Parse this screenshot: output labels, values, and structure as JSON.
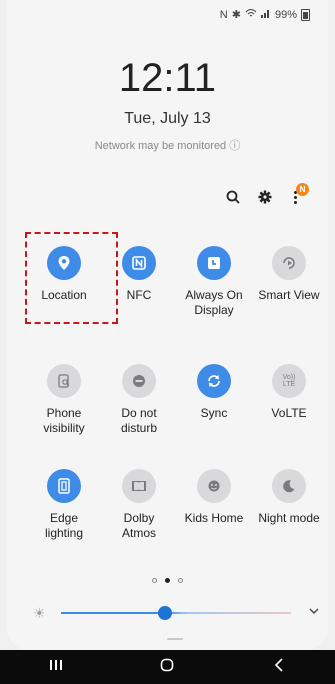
{
  "status_bar": {
    "battery": "99%",
    "icons": [
      "nfc-icon",
      "bluetooth-icon",
      "wifi-icon",
      "signal-icon",
      "battery-icon"
    ]
  },
  "lock_info": {
    "time": "12:11",
    "date": "Tue, July 13",
    "network_notice": "Network may be monitored"
  },
  "toolbar": {
    "search_icon": "search-icon",
    "settings_icon": "gear-icon",
    "more_icon": "more-vert-icon",
    "badge": "N"
  },
  "tiles": [
    {
      "label": "Location",
      "icon": "location-icon",
      "state": "on"
    },
    {
      "label": "NFC",
      "icon": "nfc-icon",
      "state": "on"
    },
    {
      "label": "Always On\nDisplay",
      "icon": "aod-icon",
      "state": "on"
    },
    {
      "label": "Smart View",
      "icon": "smart-view-icon",
      "state": "off"
    },
    {
      "label": "Phone\nvisibility",
      "icon": "phone-visibility-icon",
      "state": "off"
    },
    {
      "label": "Do not\ndisturb",
      "icon": "dnd-icon",
      "state": "off"
    },
    {
      "label": "Sync",
      "icon": "sync-icon",
      "state": "on"
    },
    {
      "label": "VoLTE",
      "icon": "volte-icon",
      "state": "off"
    },
    {
      "label": "Edge\nlighting",
      "icon": "edge-lighting-icon",
      "state": "on"
    },
    {
      "label": "Dolby\nAtmos",
      "icon": "dolby-icon",
      "state": "off"
    },
    {
      "label": "Kids Home",
      "icon": "kids-home-icon",
      "state": "off"
    },
    {
      "label": "Night mode",
      "icon": "night-mode-icon",
      "state": "off"
    }
  ],
  "pager": {
    "pages": 3,
    "active": 1
  },
  "brightness": {
    "level": 0.45
  },
  "colors": {
    "accent": "#3e8be8",
    "off": "#d9d9db",
    "highlight": "#c8161d"
  },
  "navbar": {
    "recents": "III",
    "home": "O",
    "back": "<"
  }
}
